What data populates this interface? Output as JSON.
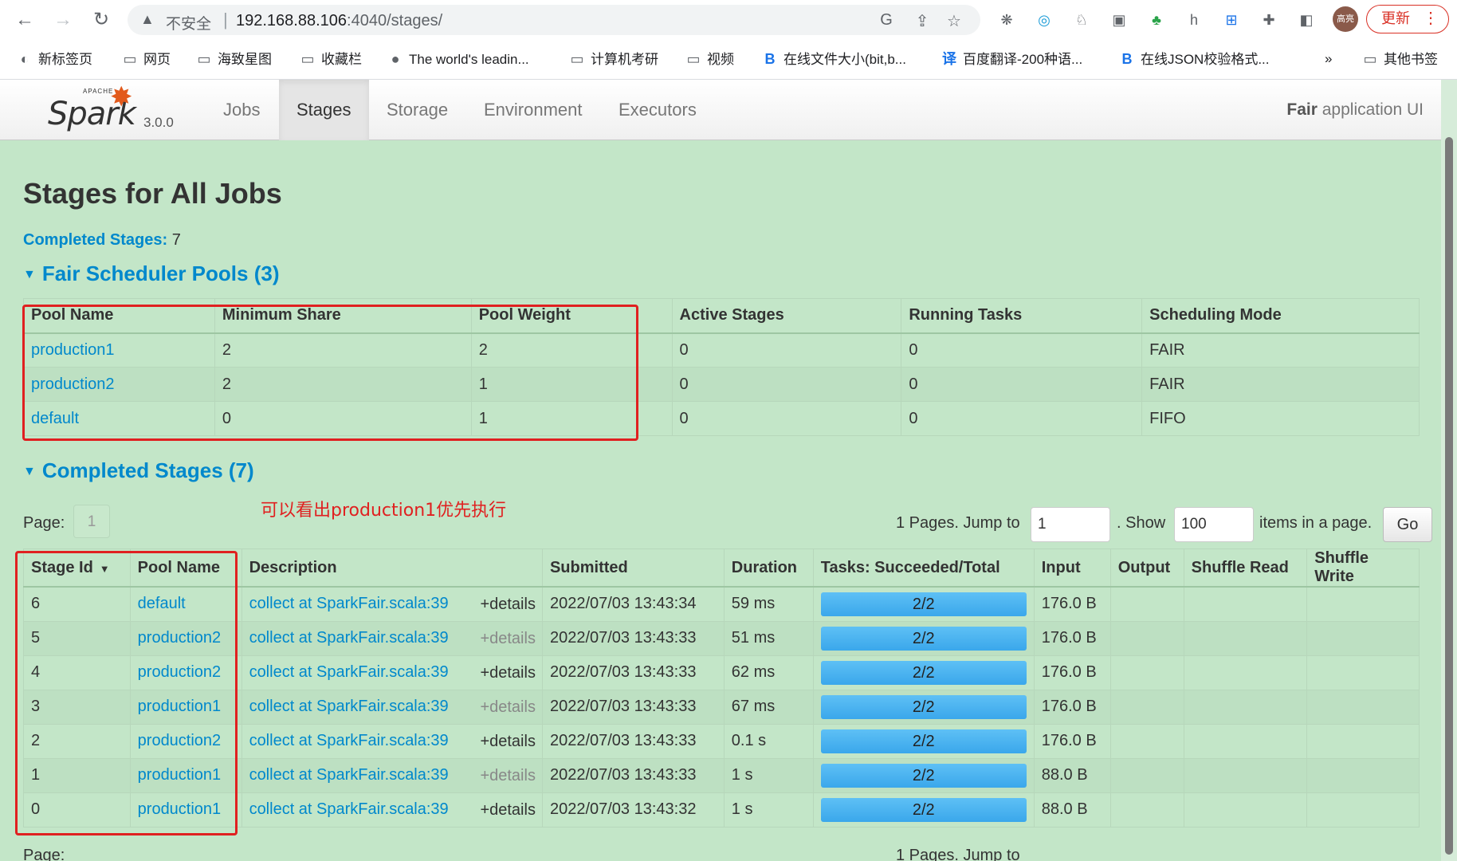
{
  "browser": {
    "insecure_label": "不安全",
    "url_host": "192.168.88.106",
    "url_path": ":4040/stages/",
    "update_label": "更新",
    "profile_label": "高亮",
    "bookmarks": [
      {
        "label": "新标签页",
        "icon": "globe-icon"
      },
      {
        "label": "网页",
        "icon": "folder-icon"
      },
      {
        "label": "海致星图",
        "icon": "folder-icon"
      },
      {
        "label": "收藏栏",
        "icon": "folder-icon"
      },
      {
        "label": "The world's leadin...",
        "icon": "github-icon"
      },
      {
        "label": "计算机考研",
        "icon": "folder-icon"
      },
      {
        "label": "视频",
        "icon": "folder-icon"
      },
      {
        "label": "在线文件大小(bit,b...",
        "icon": "b-icon"
      },
      {
        "label": "百度翻译-200种语...",
        "icon": "translate-icon"
      },
      {
        "label": "在线JSON校验格式...",
        "icon": "b-icon"
      },
      {
        "label": "»",
        "icon": ""
      },
      {
        "label": "其他书签",
        "icon": "folder-icon"
      }
    ]
  },
  "navbar": {
    "apache": "APACHE",
    "logo_text": "Spark",
    "version": "3.0.0",
    "tabs": [
      "Jobs",
      "Stages",
      "Storage",
      "Environment",
      "Executors"
    ],
    "active_tab": "Stages",
    "app_name_bold": "Fair",
    "app_name_rest": " application UI"
  },
  "page": {
    "title": "Stages for All Jobs",
    "completed_label": "Completed Stages:",
    "completed_count": "7"
  },
  "pools": {
    "heading": "Fair Scheduler Pools (3)",
    "columns": [
      "Pool Name",
      "Minimum Share",
      "Pool Weight",
      "Active Stages",
      "Running Tasks",
      "Scheduling Mode"
    ],
    "rows": [
      [
        "production1",
        "2",
        "2",
        "0",
        "0",
        "FAIR"
      ],
      [
        "production2",
        "2",
        "1",
        "0",
        "0",
        "FAIR"
      ],
      [
        "default",
        "0",
        "1",
        "0",
        "0",
        "FIFO"
      ]
    ]
  },
  "stages": {
    "heading": "Completed Stages (7)",
    "annotation": "可以看出production1优先执行",
    "page_label": "Page:",
    "page_number": "1",
    "pages_text": "1 Pages. Jump to",
    "jump_value": "1",
    "show_text": ". Show",
    "show_value": "100",
    "items_text": "items in a page.",
    "go_label": "Go",
    "columns": [
      "Stage Id",
      "Pool Name",
      "Description",
      "Submitted",
      "Duration",
      "Tasks: Succeeded/Total",
      "Input",
      "Output",
      "Shuffle Read",
      "Shuffle Write"
    ],
    "details_label": "+details",
    "rows": [
      {
        "id": "6",
        "pool": "default",
        "desc": "collect at SparkFair.scala:39",
        "submitted": "2022/07/03 13:43:34",
        "duration": "59 ms",
        "tasks": "2/2",
        "tasks_fraction": 1.0,
        "input": "176.0 B"
      },
      {
        "id": "5",
        "pool": "production2",
        "desc": "collect at SparkFair.scala:39",
        "submitted": "2022/07/03 13:43:33",
        "duration": "51 ms",
        "tasks": "2/2",
        "tasks_fraction": 1.0,
        "input": "176.0 B"
      },
      {
        "id": "4",
        "pool": "production2",
        "desc": "collect at SparkFair.scala:39",
        "submitted": "2022/07/03 13:43:33",
        "duration": "62 ms",
        "tasks": "2/2",
        "tasks_fraction": 1.0,
        "input": "176.0 B"
      },
      {
        "id": "3",
        "pool": "production1",
        "desc": "collect at SparkFair.scala:39",
        "submitted": "2022/07/03 13:43:33",
        "duration": "67 ms",
        "tasks": "2/2",
        "tasks_fraction": 1.0,
        "input": "176.0 B"
      },
      {
        "id": "2",
        "pool": "production2",
        "desc": "collect at SparkFair.scala:39",
        "submitted": "2022/07/03 13:43:33",
        "duration": "0.1 s",
        "tasks": "2/2",
        "tasks_fraction": 1.0,
        "input": "176.0 B"
      },
      {
        "id": "1",
        "pool": "production1",
        "desc": "collect at SparkFair.scala:39",
        "submitted": "2022/07/03 13:43:33",
        "duration": "1 s",
        "tasks": "2/2",
        "tasks_fraction": 1.0,
        "input": "88.0 B"
      },
      {
        "id": "0",
        "pool": "production1",
        "desc": "collect at SparkFair.scala:39",
        "submitted": "2022/07/03 13:43:32",
        "duration": "1 s",
        "tasks": "2/2",
        "tasks_fraction": 1.0,
        "input": "88.0 B"
      }
    ]
  },
  "colors": {
    "page_bg": "#c3e6c8",
    "link": "#0088cc",
    "progress": "#3aa7eb",
    "annotation": "#e02020",
    "spark_orange": "#e25a1c"
  }
}
